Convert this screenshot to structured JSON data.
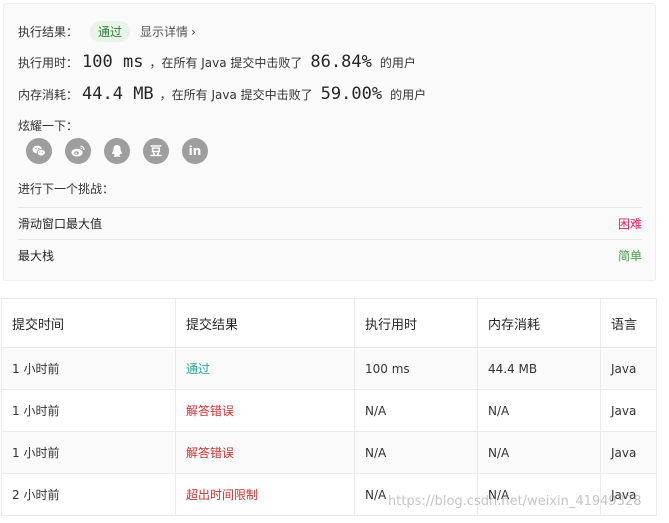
{
  "result": {
    "label": "执行结果：",
    "badge": "通过",
    "details_link": "显示详情",
    "runtime_label": "执行用时：",
    "runtime_value": "100 ms",
    "runtime_mid": "，在所有 Java 提交中击败了",
    "runtime_percent": "86.84%",
    "runtime_suffix": "的用户",
    "memory_label": "内存消耗：",
    "memory_value": "44.4 MB",
    "memory_mid": "，在所有 Java 提交中击败了",
    "memory_percent": "59.00%",
    "memory_suffix": "的用户"
  },
  "share": {
    "label": "炫耀一下：",
    "icons": [
      "wechat-icon",
      "weibo-icon",
      "qq-icon",
      "douban-icon",
      "linkedin-icon"
    ],
    "douban_glyph": "豆",
    "linkedin_glyph": "in"
  },
  "next": {
    "label": "进行下一个挑战：",
    "items": [
      {
        "title": "滑动窗口最大值",
        "difficulty": "困难",
        "color": "#e91e63"
      },
      {
        "title": "最大栈",
        "difficulty": "简单",
        "color": "#43a047"
      }
    ]
  },
  "submissions": {
    "headers": [
      "提交时间",
      "提交结果",
      "执行用时",
      "内存消耗",
      "语言"
    ],
    "rows": [
      {
        "time": "1 小时前",
        "result": "通过",
        "runtime": "100 ms",
        "memory": "44.4 MB",
        "lang": "Java"
      },
      {
        "time": "1 小时前",
        "result": "解答错误",
        "runtime": "N/A",
        "memory": "N/A",
        "lang": "Java"
      },
      {
        "time": "1 小时前",
        "result": "解答错误",
        "runtime": "N/A",
        "memory": "N/A",
        "lang": "Java"
      },
      {
        "time": "2 小时前",
        "result": "超出时间限制",
        "runtime": "N/A",
        "memory": "N/A",
        "lang": "Java"
      }
    ]
  },
  "watermark": "https://blog.csdn.net/weixin_41949328",
  "colors": {
    "pass": "#26a69a",
    "error": "#d32f2f",
    "badge_bg": "#e7f5e9"
  }
}
